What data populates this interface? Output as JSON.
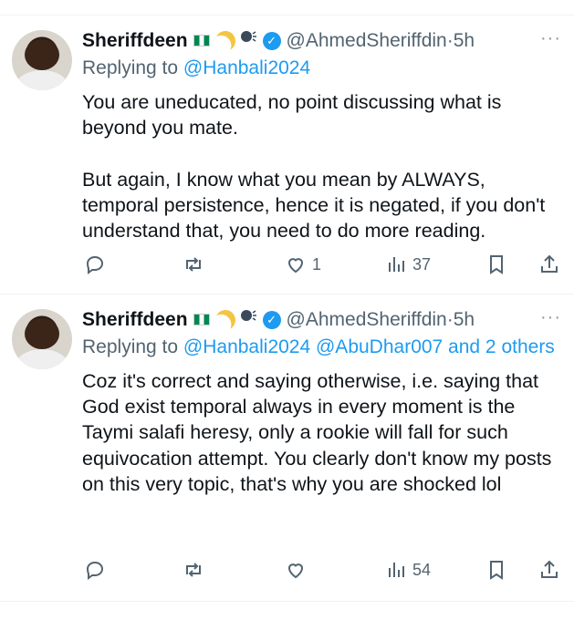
{
  "tweets": [
    {
      "name": "Sheriffdeen",
      "handle": "@AhmedSheriffdin",
      "time_sep": " · ",
      "time": "5h",
      "more": "···",
      "reply_prefix": "Replying to ",
      "reply_to": "@Hanbali2024",
      "text": "You are uneducated, no point discussing what is beyond you mate.\n\nBut again, I know what you mean by ALWAYS, temporal persistence, hence it is negated, if you don't understand that, you need to do more reading.",
      "counts": {
        "reply": "",
        "retweet": "",
        "like": "1",
        "views": "37"
      }
    },
    {
      "name": "Sheriffdeen",
      "handle": "@AhmedSheriffdin",
      "time_sep": " · ",
      "time": "5h",
      "more": "···",
      "reply_prefix": "Replying to ",
      "reply_to": "@Hanbali2024 @AbuDhar007 and 2 others",
      "text": "Coz it's correct and saying otherwise, i.e. saying that God exist temporal always in every moment is the Taymi salafi heresy, only a rookie will fall for such equivocation attempt. You clearly don't know my posts on this very topic, that's why you are shocked lol",
      "counts": {
        "reply": "",
        "retweet": "",
        "like": "",
        "views": "54"
      }
    }
  ],
  "colors": {
    "text": "#0f1419",
    "muted": "#536471",
    "link": "#1d9bf0",
    "verified": "#1d9bf0"
  },
  "icons": [
    "reply-icon",
    "retweet-icon",
    "like-icon",
    "views-icon",
    "bookmark-icon",
    "share-icon"
  ]
}
